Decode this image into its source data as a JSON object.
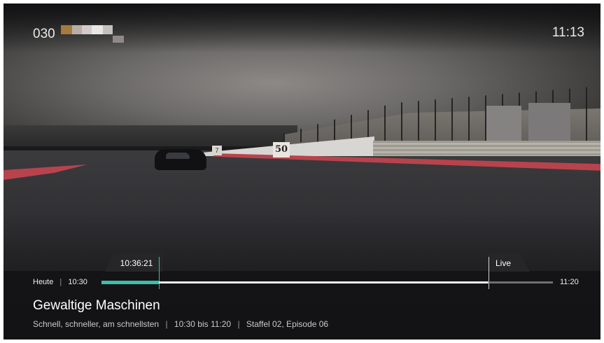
{
  "channel": {
    "number": "030",
    "logo_colors": [
      "#a47a3d",
      "#b9aea6",
      "#d2cbc8",
      "#e9e6e6",
      "#c5c0be",
      "#8f8a88"
    ]
  },
  "clock": "11:13",
  "player": {
    "position_time": "10:36:21",
    "live_label": "Live",
    "day_label": "Heute",
    "day_separator": "|",
    "start_time": "10:30",
    "end_time": "11:20",
    "watched_fraction": 0.127,
    "buffered_fraction": 0.857,
    "accent_color": "#3bbfa8"
  },
  "program": {
    "title": "Gewaltige Maschinen",
    "subtitle": "Schnell, schneller, am schnellsten",
    "separator": "|",
    "time_range": "10:30 bis 11:20",
    "episode": "Staffel 02, Episode 06"
  }
}
